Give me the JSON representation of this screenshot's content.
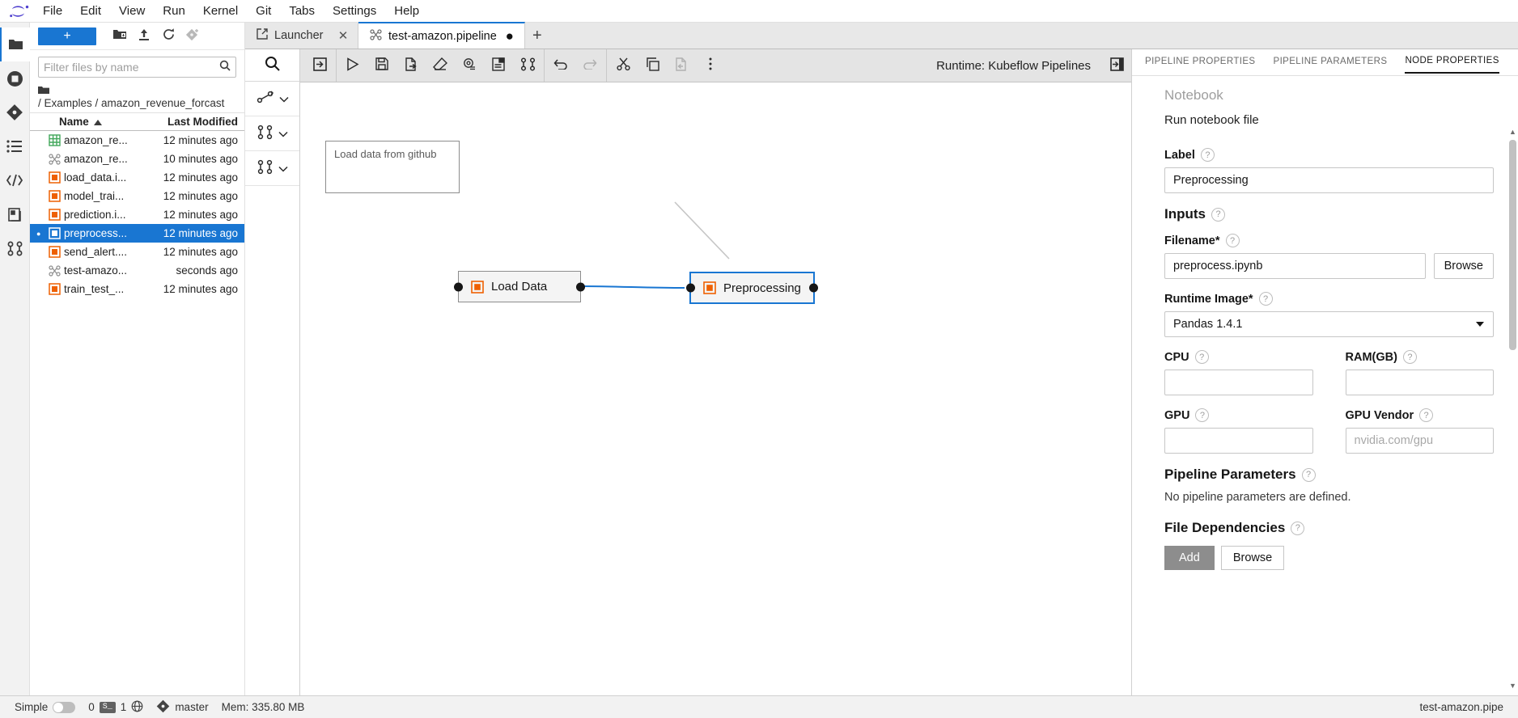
{
  "menubar": {
    "logo": "jupyter-logo",
    "items": [
      "File",
      "Edit",
      "View",
      "Run",
      "Kernel",
      "Git",
      "Tabs",
      "Settings",
      "Help"
    ]
  },
  "rail": {
    "items": [
      {
        "name": "file-browser",
        "icon": "folder-icon",
        "active": true
      },
      {
        "name": "running-terminals",
        "icon": "stop-circle-icon",
        "active": false
      },
      {
        "name": "git-panel",
        "icon": "git-diamond-icon",
        "active": false
      },
      {
        "name": "table-of-contents",
        "icon": "list-icon",
        "active": false
      },
      {
        "name": "extension-manager",
        "icon": "code-brackets-icon",
        "active": false
      },
      {
        "name": "elyra-catalog",
        "icon": "catalog-icon",
        "active": false
      },
      {
        "name": "pipeline-palette",
        "icon": "nodes-icon",
        "active": false
      }
    ]
  },
  "filebrowser": {
    "new_button_label": "+",
    "toolbar_icons": [
      "new-folder-icon",
      "upload-icon",
      "refresh-icon",
      "new-git-icon"
    ],
    "filter_placeholder": "Filter files by name",
    "filter_value": "",
    "breadcrumb_path": "/ Examples / amazon_revenue_forcast",
    "columns": {
      "name": "Name",
      "modified": "Last Modified"
    },
    "sort_indicator": "ascending",
    "files": [
      {
        "name": "amazon_re...",
        "modified": "12 minutes ago",
        "icon": "csv-icon",
        "selected": false
      },
      {
        "name": "amazon_re...",
        "modified": "10 minutes ago",
        "icon": "pipeline-icon",
        "selected": false
      },
      {
        "name": "load_data.i...",
        "modified": "12 minutes ago",
        "icon": "notebook-icon",
        "selected": false
      },
      {
        "name": "model_trai...",
        "modified": "12 minutes ago",
        "icon": "notebook-icon",
        "selected": false
      },
      {
        "name": "prediction.i...",
        "modified": "12 minutes ago",
        "icon": "notebook-icon",
        "selected": false
      },
      {
        "name": "preprocess...",
        "modified": "12 minutes ago",
        "icon": "notebook-icon",
        "selected": true
      },
      {
        "name": "send_alert....",
        "modified": "12 minutes ago",
        "icon": "notebook-icon",
        "selected": false
      },
      {
        "name": "test-amazo...",
        "modified": "seconds ago",
        "icon": "pipeline-icon",
        "selected": false
      },
      {
        "name": "train_test_...",
        "modified": "12 minutes ago",
        "icon": "notebook-icon",
        "selected": false
      }
    ]
  },
  "tabs": [
    {
      "label": "Launcher",
      "icon": "launcher-icon",
      "active": false,
      "dirty": false,
      "close": "✕"
    },
    {
      "label": "test-amazon.pipeline",
      "icon": "pipeline-icon",
      "active": true,
      "dirty": true,
      "close": "✕"
    }
  ],
  "tab_add_label": "+",
  "palette": {
    "search_icon": "search-icon",
    "categories": [
      {
        "name": "elyra-generic-category",
        "icon": "generic-nodes-icon",
        "chevron": "chevron-down-icon"
      },
      {
        "name": "kubeflow-category",
        "icon": "kubeflow-nodes-icon",
        "chevron": "chevron-down-icon"
      },
      {
        "name": "airflow-category",
        "icon": "airflow-nodes-icon",
        "chevron": "chevron-down-icon"
      }
    ]
  },
  "pipeline_toolbar": {
    "buttons": [
      {
        "name": "open-palette-button",
        "icon": "panel-open-icon",
        "disabled": false
      },
      {
        "name": "run-pipeline-button",
        "icon": "play-icon",
        "disabled": false
      },
      {
        "name": "save-pipeline-button",
        "icon": "save-icon",
        "disabled": false
      },
      {
        "name": "export-pipeline-button",
        "icon": "export-icon",
        "disabled": false
      },
      {
        "name": "clear-pipeline-button",
        "icon": "eraser-icon",
        "disabled": false
      },
      {
        "name": "pipeline-properties-button",
        "icon": "settings-gear-icon",
        "disabled": false
      },
      {
        "name": "toggle-comment-button",
        "icon": "comment-icon",
        "disabled": false
      },
      {
        "name": "add-node-button",
        "icon": "nodes-icon",
        "disabled": false
      },
      {
        "name": "undo-button",
        "icon": "undo-arrow-icon",
        "disabled": false
      },
      {
        "name": "redo-button",
        "icon": "redo-arrow-icon",
        "disabled": true
      },
      {
        "name": "cut-button",
        "icon": "scissors-icon",
        "disabled": false
      },
      {
        "name": "copy-button",
        "icon": "copy-icon",
        "disabled": false
      },
      {
        "name": "paste-button",
        "icon": "paste-icon",
        "disabled": true
      },
      {
        "name": "overflow-menu-button",
        "icon": "kebab-menu-icon",
        "disabled": false
      }
    ],
    "runtime_label": "Runtime: Kubeflow Pipelines",
    "collapse_panel_icon": "panel-collapse-icon"
  },
  "canvas": {
    "comment": {
      "text": "Load data from github"
    },
    "nodes": [
      {
        "label": "Load Data",
        "icon": "notebook-icon",
        "selected": false
      },
      {
        "label": "Preprocessing",
        "icon": "notebook-icon",
        "selected": true
      }
    ]
  },
  "properties": {
    "tabs": [
      {
        "label": "PIPELINE PROPERTIES",
        "active": false
      },
      {
        "label": "PIPELINE PARAMETERS",
        "active": false
      },
      {
        "label": "NODE PROPERTIES",
        "active": true
      }
    ],
    "kind": "Notebook",
    "description": "Run notebook file",
    "help_glyph": "?",
    "fields": {
      "label": {
        "title": "Label",
        "value": "Preprocessing",
        "placeholder": ""
      },
      "inputs_heading": "Inputs",
      "filename": {
        "title": "Filename*",
        "value": "preprocess.ipynb",
        "placeholder": "",
        "browse_label": "Browse"
      },
      "runtime_image": {
        "title": "Runtime Image*",
        "value": "Pandas 1.4.1"
      },
      "cpu": {
        "title": "CPU",
        "value": "",
        "placeholder": ""
      },
      "ram": {
        "title": "RAM(GB)",
        "value": "",
        "placeholder": ""
      },
      "gpu": {
        "title": "GPU",
        "value": "",
        "placeholder": ""
      },
      "gpu_vendor": {
        "title": "GPU Vendor",
        "value": "",
        "placeholder": "nvidia.com/gpu"
      },
      "pipeline_parameters": {
        "title": "Pipeline Parameters",
        "note": "No pipeline parameters are defined."
      },
      "file_dependencies": {
        "title": "File Dependencies",
        "add_label": "Add",
        "browse_label": "Browse"
      }
    }
  },
  "statusbar": {
    "mode_label": "Simple",
    "mode_on": false,
    "terminals_count": "0",
    "kernel_badge": "S_",
    "kernels_count": "1",
    "globe_icon": "globe-icon",
    "git_icon": "git-diamond-icon",
    "branch": "master",
    "memory": "Mem: 335.80 MB",
    "right_label": "test-amazon.pipe"
  },
  "colors": {
    "accent": "#1976d2",
    "selection": "#1976d2",
    "notebook_icon": "#ee6002",
    "csv_icon": "#4caf50",
    "toolbar_bg": "#e4e4e4"
  }
}
